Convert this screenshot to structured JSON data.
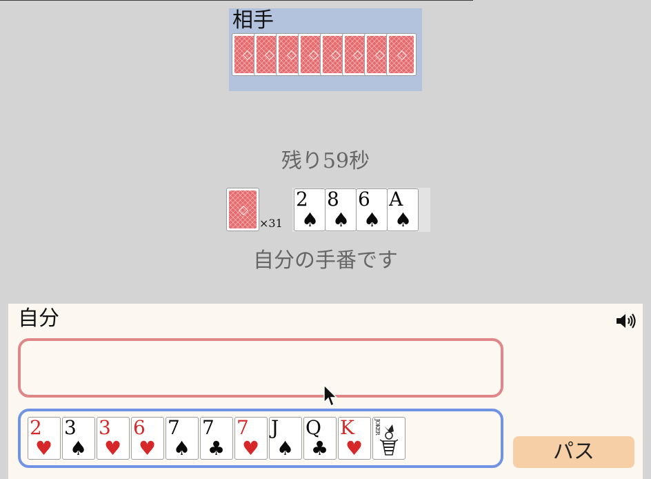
{
  "opponent": {
    "title": "相手",
    "card_count": 8
  },
  "timer": "残り59秒",
  "deck": {
    "count_label": "×31"
  },
  "field": {
    "cards": [
      {
        "rank": "2",
        "suit": "♠",
        "color": "black"
      },
      {
        "rank": "8",
        "suit": "♠",
        "color": "black"
      },
      {
        "rank": "6",
        "suit": "♠",
        "color": "black"
      },
      {
        "rank": "A",
        "suit": "♠",
        "color": "black"
      }
    ]
  },
  "status": "自分の手番です",
  "player": {
    "title": "自分",
    "sound_icon": "speaker-icon",
    "pass_label": "パス",
    "hand": [
      {
        "rank": "2",
        "suit": "♥",
        "color": "red"
      },
      {
        "rank": "3",
        "suit": "♠",
        "color": "black"
      },
      {
        "rank": "3",
        "suit": "♥",
        "color": "red"
      },
      {
        "rank": "6",
        "suit": "♥",
        "color": "red"
      },
      {
        "rank": "7",
        "suit": "♠",
        "color": "black"
      },
      {
        "rank": "7",
        "suit": "♣",
        "color": "black"
      },
      {
        "rank": "7",
        "suit": "♥",
        "color": "red"
      },
      {
        "rank": "J",
        "suit": "♠",
        "color": "black"
      },
      {
        "rank": "Q",
        "suit": "♣",
        "color": "black"
      },
      {
        "rank": "K",
        "suit": "♥",
        "color": "red"
      },
      {
        "rank": "JOKER",
        "suit": "",
        "color": "black",
        "joker": true
      }
    ]
  },
  "colors": {
    "background": "#d4d4d4",
    "opponent_panel": "#b3c3dd",
    "player_panel": "#fcf8ef",
    "select_border": "#e08588",
    "hand_border": "#7093e4",
    "card_back": "#e56b6f",
    "pass_button": "#f6cfa7",
    "red_suit": "#d62828"
  }
}
